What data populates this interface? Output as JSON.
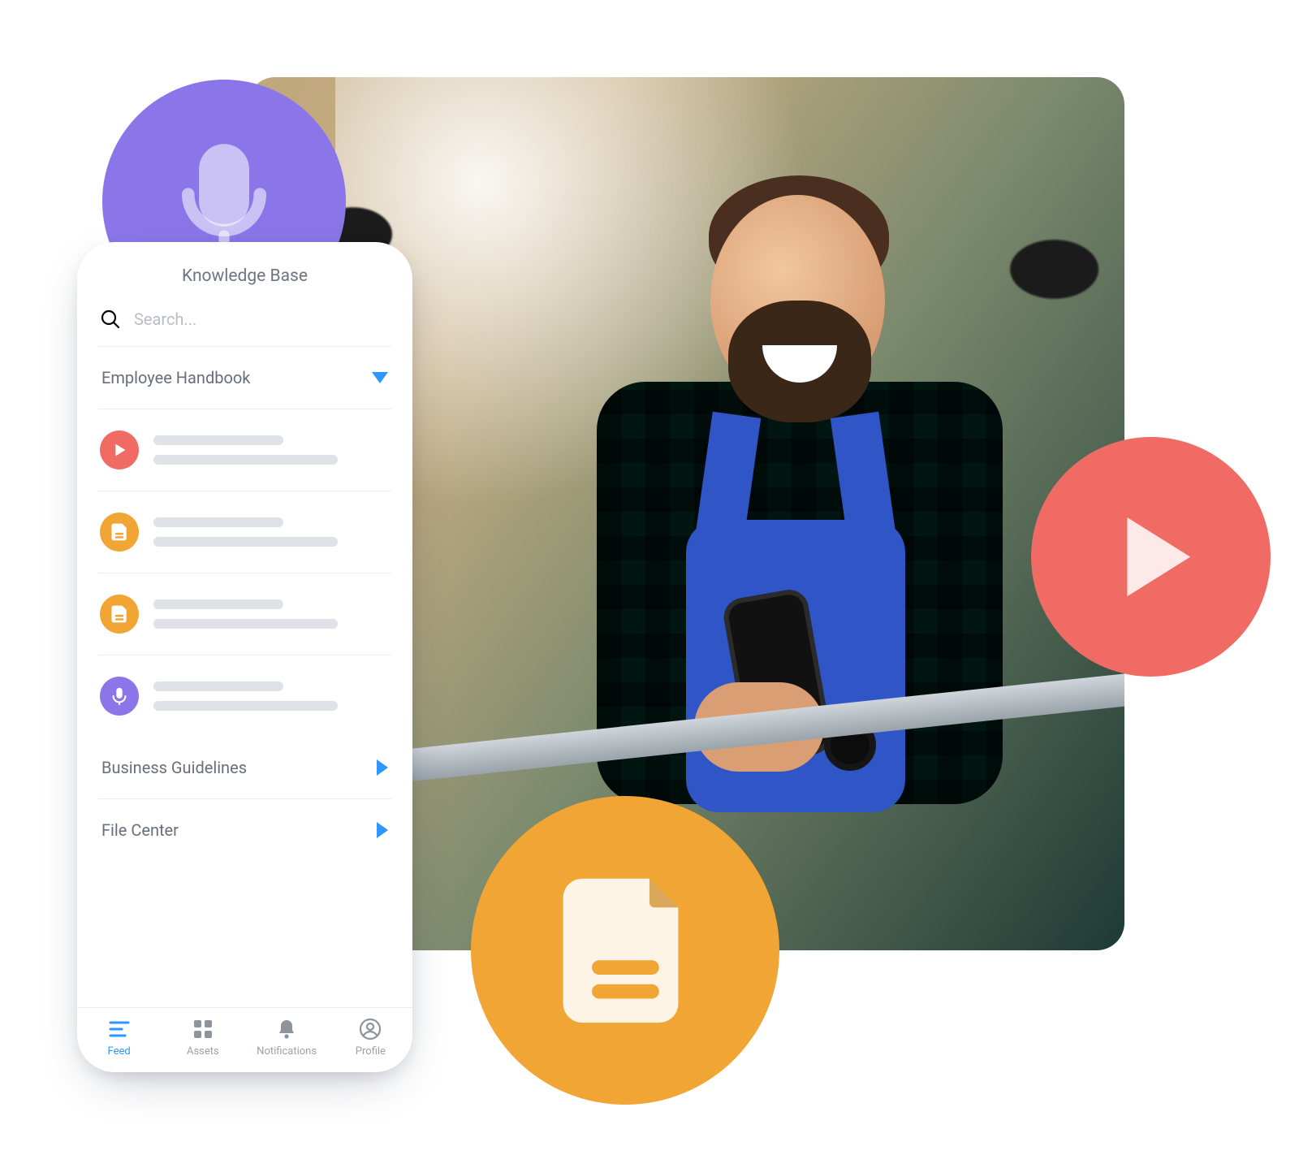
{
  "colors": {
    "accent": "#2e97ff",
    "play": "#f06b63",
    "doc": "#f1a534",
    "mic": "#8b76e9"
  },
  "floating_icons": {
    "mic": "microphone-icon",
    "play": "play-icon",
    "doc": "document-icon"
  },
  "phone": {
    "title": "Knowledge Base",
    "search": {
      "placeholder": "Search..."
    },
    "sections": [
      {
        "label": "Employee Handbook",
        "expanded": true,
        "items": [
          {
            "icon": "play"
          },
          {
            "icon": "doc"
          },
          {
            "icon": "doc"
          },
          {
            "icon": "mic"
          }
        ]
      },
      {
        "label": "Business Guidelines",
        "expanded": false
      },
      {
        "label": "File Center",
        "expanded": false
      }
    ],
    "tabs": [
      {
        "label": "Feed",
        "icon": "feed",
        "active": true
      },
      {
        "label": "Assets",
        "icon": "assets",
        "active": false
      },
      {
        "label": "Notifications",
        "icon": "bell",
        "active": false
      },
      {
        "label": "Profile",
        "icon": "profile",
        "active": false
      }
    ]
  }
}
